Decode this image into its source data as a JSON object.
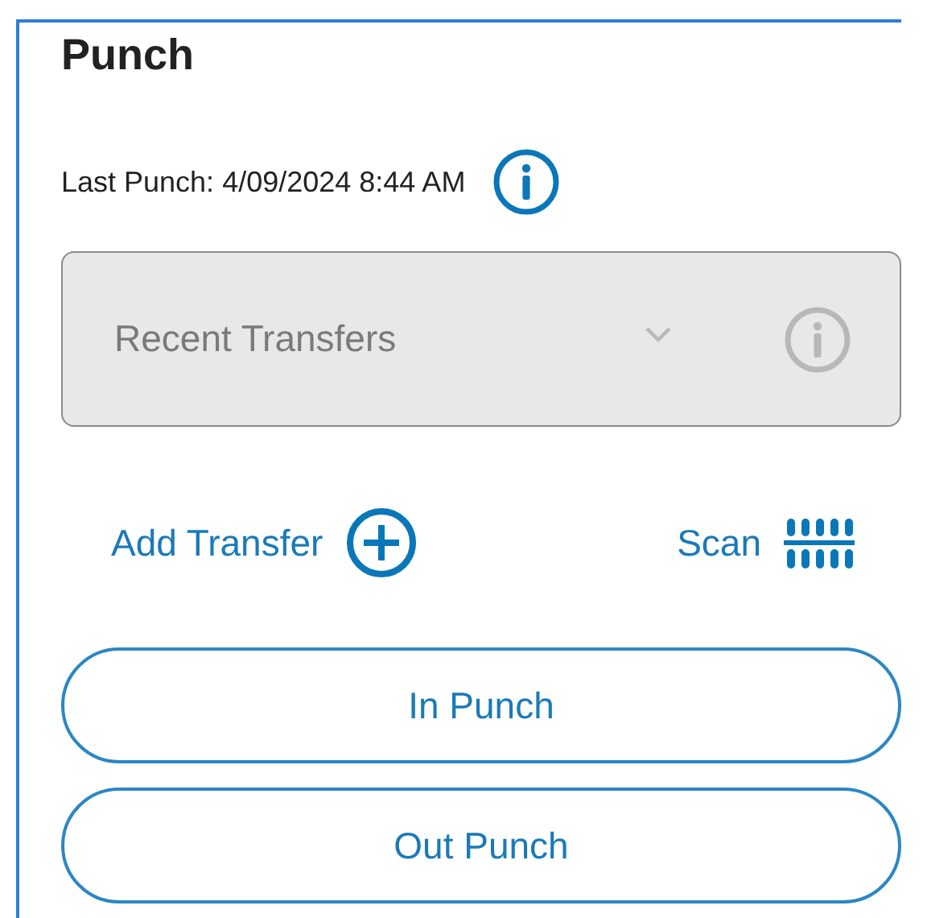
{
  "panel": {
    "title": "Punch",
    "last_punch": "Last Punch: 4/09/2024 8:44 AM",
    "dropdown": {
      "placeholder": "Recent Transfers",
      "disabled": true
    },
    "links": [
      {
        "label": "Add Transfer",
        "kind": "add"
      },
      {
        "label": "Scan",
        "kind": "scan"
      }
    ],
    "buttons": [
      "In Punch",
      "Out Punch"
    ]
  }
}
